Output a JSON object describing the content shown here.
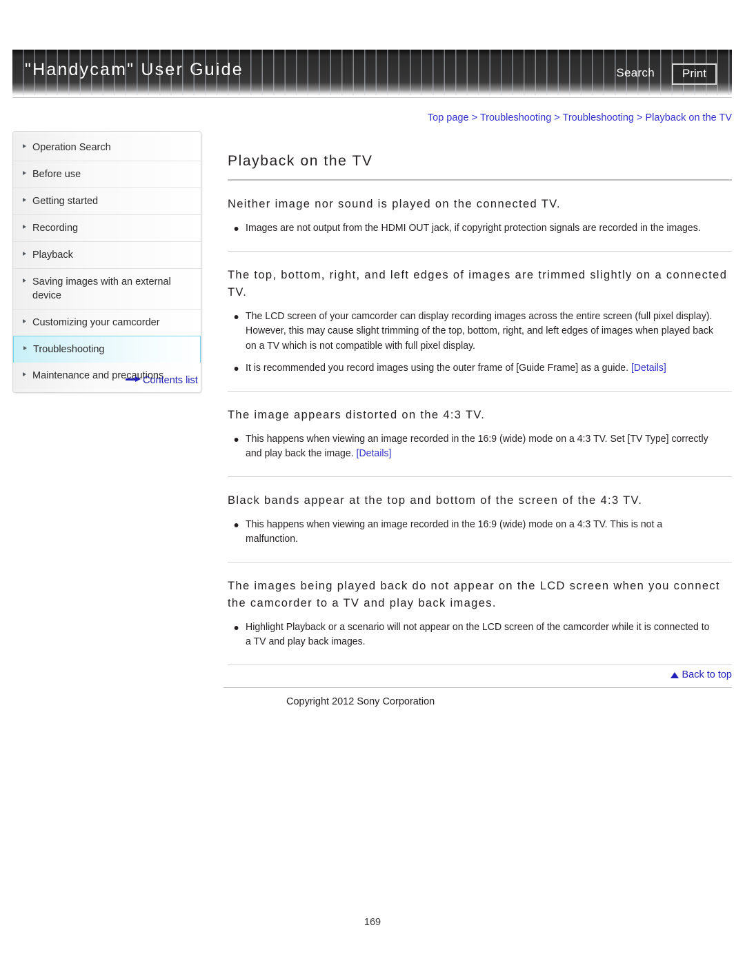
{
  "header": {
    "title": "\"Handycam\" User Guide",
    "search_label": "Search",
    "print_label": "Print"
  },
  "breadcrumb": {
    "items": [
      "Top page",
      "Troubleshooting",
      "Troubleshooting",
      "Playback on the TV"
    ],
    "separator": ">"
  },
  "sidebar": {
    "items": [
      {
        "label": "Operation Search",
        "selected": false
      },
      {
        "label": "Before use",
        "selected": false
      },
      {
        "label": "Getting started",
        "selected": false
      },
      {
        "label": "Recording",
        "selected": false
      },
      {
        "label": "Playback",
        "selected": false
      },
      {
        "label": "Saving images with an external device",
        "selected": false
      },
      {
        "label": "Customizing your camcorder",
        "selected": false
      },
      {
        "label": "Troubleshooting",
        "selected": true
      },
      {
        "label": "Maintenance and precautions",
        "selected": false
      }
    ],
    "contents_list_label": "Contents list"
  },
  "main": {
    "page_title": "Playback on the TV",
    "sections": [
      {
        "heading": "Neither image nor sound is played on the connected TV.",
        "bullets": [
          {
            "text": "Images are not output from the HDMI OUT jack, if copyright protection signals are recorded in the images.",
            "link": null
          }
        ]
      },
      {
        "heading": "The top, bottom, right, and left edges of images are trimmed slightly on a connected TV.",
        "bullets": [
          {
            "text": "The LCD screen of your camcorder can display recording images across the entire screen (full pixel display). However, this may cause slight trimming of the top, bottom, right, and left edges of images when played back on a TV which is not compatible with full pixel display.",
            "link": null
          },
          {
            "text": "It is recommended you record images using the outer frame of [Guide Frame] as a guide.",
            "link": "[Details]"
          }
        ]
      },
      {
        "heading": "The image appears distorted on the 4:3 TV.",
        "bullets": [
          {
            "text": "This happens when viewing an image recorded in the 16:9 (wide) mode on a 4:3 TV. Set [TV Type] correctly and play back the image.",
            "link": "[Details]"
          }
        ]
      },
      {
        "heading": "Black bands appear at the top and bottom of the screen of the 4:3 TV.",
        "bullets": [
          {
            "text": "This happens when viewing an image recorded in the 16:9 (wide) mode on a 4:3 TV. This is not a malfunction.",
            "link": null
          }
        ]
      },
      {
        "heading": "The images being played back do not appear on the LCD screen when you connect the camcorder to a TV and play back images.",
        "bullets": [
          {
            "text": "Highlight Playback or a scenario will not appear on the LCD screen of the camcorder while it is connected to a TV and play back images.",
            "link": null
          }
        ]
      }
    ]
  },
  "footer": {
    "back_to_top_label": "Back to top",
    "copyright": "Copyright 2012 Sony Corporation"
  },
  "page_number": "169",
  "colors": {
    "link": "#3333cc",
    "selected_nav_border": "#6fd4e8",
    "header_dark": "#2b2b2b"
  }
}
